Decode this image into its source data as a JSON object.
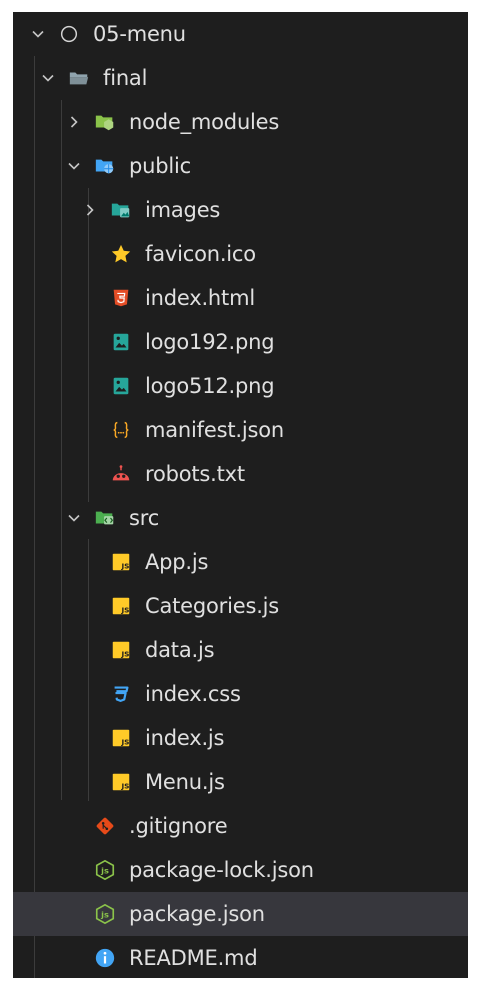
{
  "explorer": {
    "items": [
      {
        "label": "05-menu",
        "name": "project-05-menu"
      },
      {
        "label": "final",
        "name": "folder-final"
      },
      {
        "label": "node_modules",
        "name": "folder-node-modules"
      },
      {
        "label": "public",
        "name": "folder-public"
      },
      {
        "label": "images",
        "name": "folder-images"
      },
      {
        "label": "favicon.ico",
        "name": "file-favicon-ico"
      },
      {
        "label": "index.html",
        "name": "file-index-html"
      },
      {
        "label": "logo192.png",
        "name": "file-logo192-png"
      },
      {
        "label": "logo512.png",
        "name": "file-logo512-png"
      },
      {
        "label": "manifest.json",
        "name": "file-manifest-json"
      },
      {
        "label": "robots.txt",
        "name": "file-robots-txt"
      },
      {
        "label": "src",
        "name": "folder-src"
      },
      {
        "label": "App.js",
        "name": "file-app-js"
      },
      {
        "label": "Categories.js",
        "name": "file-categories-js"
      },
      {
        "label": "data.js",
        "name": "file-data-js"
      },
      {
        "label": "index.css",
        "name": "file-index-css"
      },
      {
        "label": "index.js",
        "name": "file-index-js"
      },
      {
        "label": "Menu.js",
        "name": "file-menu-js"
      },
      {
        "label": ".gitignore",
        "name": "file-gitignore"
      },
      {
        "label": "package-lock.json",
        "name": "file-package-lock-json"
      },
      {
        "label": "package.json",
        "name": "file-package-json"
      },
      {
        "label": "README.md",
        "name": "file-readme-md"
      }
    ]
  },
  "icons": {
    "chevron_color": "#c5c5c5",
    "folder_color": "#90a4ae",
    "node_folder_color": "#8bc34a",
    "public_folder_color": "#42a5f5",
    "images_folder_color": "#26a69a",
    "src_folder_color": "#4caf50",
    "favicon_color": "#ffca28",
    "html_color": "#e44d26",
    "image_file_color": "#26a69a",
    "json_color": "#f9a825",
    "robots_color": "#ef5350",
    "js_color": "#ffca28",
    "css_color": "#42a5f5",
    "git_color": "#e64a19",
    "node_color": "#8bc34a",
    "info_color": "#42a5f5"
  }
}
